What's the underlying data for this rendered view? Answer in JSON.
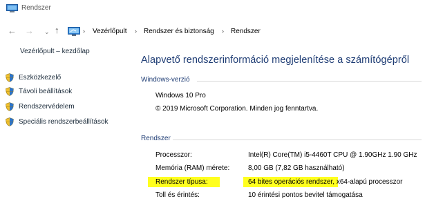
{
  "window": {
    "title": "Rendszer"
  },
  "address": {
    "crumbs": [
      "Vezérlőpult",
      "Rendszer és biztonság",
      "Rendszer"
    ],
    "separator": "›"
  },
  "sidebar": {
    "home": "Vezérlőpult – kezdőlap",
    "items": [
      {
        "label": "Eszközkezelő",
        "icon": "shield-icon"
      },
      {
        "label": "Távoli beállítások",
        "icon": "shield-icon"
      },
      {
        "label": "Rendszervédelem",
        "icon": "shield-icon"
      },
      {
        "label": "Speciális rendszerbeállítások",
        "icon": "shield-icon"
      }
    ]
  },
  "main": {
    "title": "Alapvető rendszerinformáció megjelenítése a számítógépről",
    "windows_section": {
      "heading": "Windows-verzió",
      "edition": "Windows 10 Pro",
      "copyright": "© 2019 Microsoft Corporation. Minden jog fenntartva."
    },
    "system_section": {
      "heading": "Rendszer",
      "rows": [
        {
          "label": "Processzor:",
          "value": "Intel(R) Core(TM) i5-4460T CPU @ 1.90GHz   1.90 GHz",
          "value_rest": ""
        },
        {
          "label": "Memória (RAM) mérete:",
          "value": "8,00 GB (7,82 GB használható)",
          "value_rest": ""
        },
        {
          "label": "Rendszer típusa:",
          "value": "64 bites operációs rendszer",
          "value_rest": ", x64-alapú processzor"
        },
        {
          "label": "Toll és érintés:",
          "value": "10 érintési pontos bevitel támogatása",
          "value_rest": ""
        }
      ]
    }
  },
  "colors": {
    "heading": "#1e3c74",
    "link": "#1b2b3a",
    "highlight": "#ffff1f"
  }
}
